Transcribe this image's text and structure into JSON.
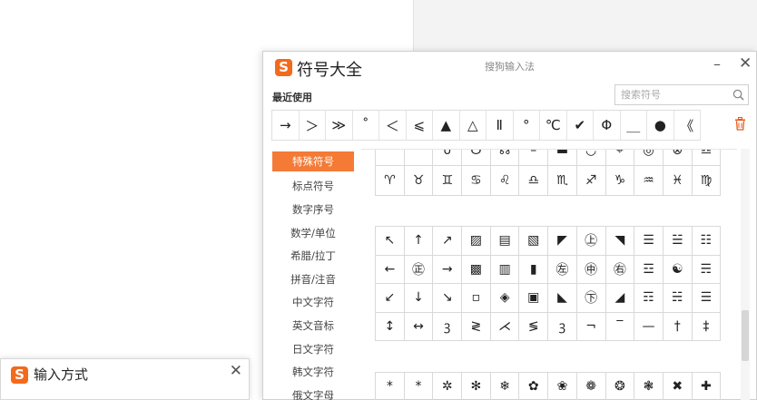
{
  "symbol_window": {
    "title": "符号大全",
    "brand": "搜狗输入法",
    "minimize": "–",
    "close": "✕",
    "recent_label": "最近使用",
    "search": {
      "placeholder": "搜索符号",
      "value": ""
    },
    "recent": [
      "→",
      "＞",
      "≫",
      "˚",
      "＜",
      "⩽",
      "▲",
      "△",
      "Ⅱ",
      "°",
      "℃",
      "✔",
      "Φ",
      "＿",
      "●",
      "《"
    ]
  },
  "sidebar": {
    "items": [
      "特殊符号",
      "标点符号",
      "数字序号",
      "数学/单位",
      "希腊/拉丁",
      "拼音/注音",
      "中文字符",
      "英文音标",
      "日文字符",
      "韩文字符",
      "俄文字母"
    ]
  },
  "grid1": [
    "˚",
    "˚",
    "∪",
    "☋",
    "☊",
    "–",
    "▬",
    "◡",
    "⌖",
    "◎",
    "⊗",
    "♎",
    "♈",
    "♉",
    "♊",
    "♋",
    "♌",
    "♎",
    "♏",
    "♐",
    "♑",
    "♒",
    "♓",
    "♍"
  ],
  "grid2": [
    "↖",
    "↑",
    "↗",
    "▨",
    "▤",
    "▧",
    "◤",
    "㊤",
    "◥",
    "☰",
    "☱",
    "☷",
    "←",
    "㊣",
    "→",
    "▩",
    "▥",
    "▮",
    "㊧",
    "㊥",
    "㊨",
    "☲",
    "☯",
    "☴",
    "↙",
    "↓",
    "↘",
    "▫",
    "◈",
    "▣",
    "◣",
    "㊦",
    "◢",
    "☶",
    "☵",
    "☰",
    "↕",
    "↔",
    "ꝫ",
    "≷",
    "⋌",
    "≶",
    "ꝫ",
    "¬",
    "‾",
    "—",
    "†",
    "‡"
  ],
  "grid3": [
    "*",
    "*",
    "✲",
    "✻",
    "❄",
    "✿",
    "❀",
    "❁",
    "❂",
    "❃",
    "✖",
    "✚"
  ],
  "im_window": {
    "title": "输入方式",
    "close": "✕"
  }
}
